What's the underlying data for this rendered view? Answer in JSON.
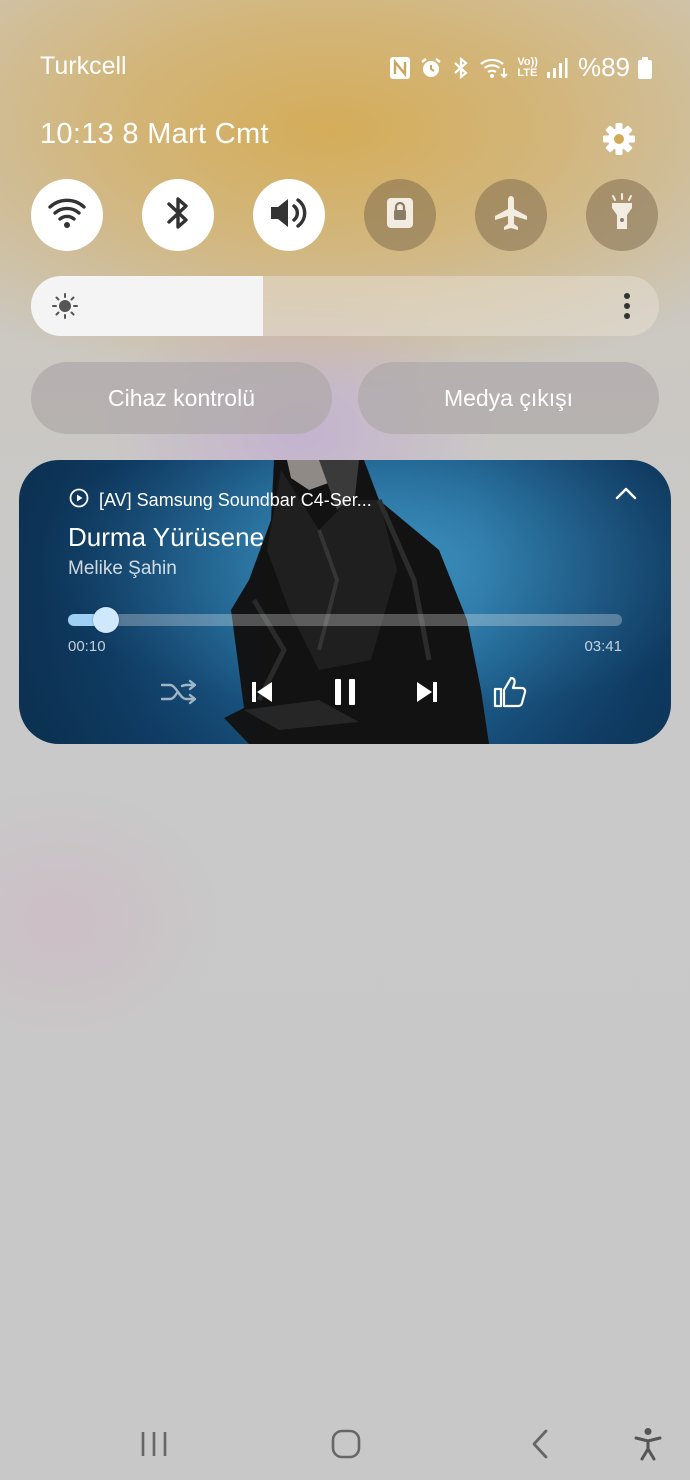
{
  "status_bar": {
    "carrier": "Turkcell",
    "battery_text": "%89",
    "icons": [
      "nfc-icon",
      "alarm-icon",
      "bluetooth-icon",
      "wifi-call-icon",
      "volte-icon",
      "signal-icon",
      "battery-icon"
    ],
    "volte_label_top": "Vo))",
    "volte_label_bottom": "LTE"
  },
  "header": {
    "time_date": "10:13  8 Mart Cmt",
    "settings_icon": "gear-icon"
  },
  "quick_toggles": [
    {
      "name": "wifi",
      "icon": "wifi-icon",
      "state": "on"
    },
    {
      "name": "bluetooth",
      "icon": "bluetooth-icon",
      "state": "on"
    },
    {
      "name": "sound",
      "icon": "volume-icon",
      "state": "on"
    },
    {
      "name": "screen-lock",
      "icon": "lock-rotate-icon",
      "state": "off"
    },
    {
      "name": "airplane",
      "icon": "airplane-icon",
      "state": "off"
    },
    {
      "name": "flashlight",
      "icon": "flashlight-icon",
      "state": "off"
    }
  ],
  "brightness": {
    "level": 0.37,
    "icon": "sun-icon",
    "menu_icon": "more-vertical-icon"
  },
  "pills": {
    "device_control": "Cihaz kontrolü",
    "media_output": "Medya çıkışı"
  },
  "media": {
    "source": "[AV] Samsung Soundbar C4-Ser...",
    "title": "Durma Yürüsene",
    "artist": "Melike Şahin",
    "elapsed": "00:10",
    "total": "03:41",
    "progress": 0.045,
    "controls": [
      "shuffle-icon",
      "skip-previous-icon",
      "pause-icon",
      "skip-next-icon",
      "thumbs-up-icon"
    ],
    "accent_color": "#9ed0f5"
  },
  "nav_bar": {
    "buttons": [
      "recents-icon",
      "home-icon",
      "back-icon",
      "accessibility-icon"
    ]
  }
}
